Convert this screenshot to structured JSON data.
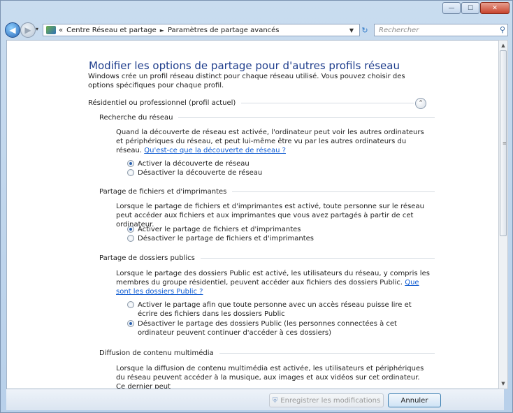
{
  "window": {
    "caption_minimize": "—",
    "caption_maximize": "☐",
    "caption_close": "✕"
  },
  "nav": {
    "back_glyph": "◀",
    "forward_glyph": "▶",
    "recent_glyph": "▾",
    "breadcrumb_prefix": "«",
    "breadcrumb": [
      "Centre Réseau et partage",
      "Paramètres de partage avancés"
    ],
    "breadcrumb_separator": "►",
    "dropdown_glyph": "▼",
    "refresh_glyph": "↻",
    "search_placeholder": "Rechercher",
    "search_glyph": "⚲"
  },
  "page": {
    "title": "Modifier les options de partage pour d'autres profils réseau",
    "intro": "Windows crée un profil réseau distinct pour chaque réseau utilisé. Vous pouvez choisir des options spécifiques pour chaque profil.",
    "profile_header": "Résidentiel ou professionnel (profil actuel)",
    "collapse_glyph": "⌃",
    "sections": {
      "discovery": {
        "title": "Recherche du réseau",
        "description": "Quand la découverte de réseau est activée, l'ordinateur peut voir les autres ordinateurs et périphériques du réseau, et peut lui-même être vu par les autres ordinateurs du réseau.",
        "link": "Qu'est-ce que la découverte de réseau ?",
        "options": [
          {
            "label": "Activer la découverte de réseau",
            "selected": true
          },
          {
            "label": "Désactiver la découverte de réseau",
            "selected": false
          }
        ]
      },
      "file_sharing": {
        "title": "Partage de fichiers et d'imprimantes",
        "description": "Lorsque le partage de fichiers et d'imprimantes est activé, toute personne sur le réseau peut accéder aux fichiers et aux imprimantes que vous avez partagés à partir de cet ordinateur.",
        "options": [
          {
            "label": "Activer le partage de fichiers et d'imprimantes",
            "selected": true
          },
          {
            "label": "Désactiver le partage de fichiers et d'imprimantes",
            "selected": false
          }
        ]
      },
      "public_folders": {
        "title": "Partage de dossiers publics",
        "description": "Lorsque le partage des dossiers Public est activé, les utilisateurs du réseau, y compris les membres du groupe résidentiel, peuvent accéder aux fichiers des dossiers Public.",
        "link": "Que sont les dossiers Public ?",
        "options": [
          {
            "label": "Activer le partage afin que toute personne avec un accès réseau puisse lire et écrire des fichiers dans les dossiers Public",
            "selected": false
          },
          {
            "label": "Désactiver le partage des dossiers Public (les personnes connectées à cet ordinateur peuvent continuer d'accéder à ces dossiers)",
            "selected": true
          }
        ]
      },
      "media": {
        "title": "Diffusion de contenu multimédia",
        "description": "Lorsque la diffusion de contenu multimédia est activée, les utilisateurs et périphériques du réseau peuvent accéder à la musique, aux images et aux vidéos sur cet ordinateur. Ce dernier peut"
      }
    }
  },
  "scrollbar": {
    "up_glyph": "▲",
    "down_glyph": "▼",
    "grip_glyph": "≡"
  },
  "footer": {
    "save_label": "Enregistrer les modifications",
    "save_enabled": false,
    "shield_glyph": "⛨",
    "cancel_label": "Annuler"
  },
  "colors": {
    "title_blue": "#1e3d8c",
    "link_blue": "#0f5bd1",
    "radio_selected": "#2b62b0"
  }
}
